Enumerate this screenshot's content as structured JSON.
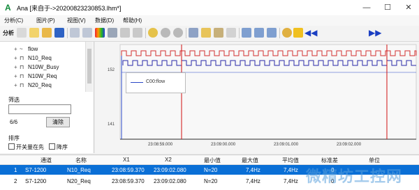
{
  "window": {
    "title": "Ana   [来自于->20200823230853.lhm*]",
    "app_letter": "A"
  },
  "menu": [
    "分析(C)",
    "图片(P)",
    "视图(V)",
    "数据(D)",
    "帮助(H)"
  ],
  "toolbar": {
    "first_label": "分析"
  },
  "tree": {
    "items": [
      {
        "icon": "~",
        "label": "flow"
      },
      {
        "icon": "⊓",
        "label": "N10_Req"
      },
      {
        "icon": "⊓",
        "label": "N10W_Busy"
      },
      {
        "icon": "⊓",
        "label": "N10W_Req"
      },
      {
        "icon": "⊓",
        "label": "N20_Req"
      }
    ]
  },
  "filter": {
    "label": "筛选",
    "count": "6/6",
    "clear_label": "清除"
  },
  "sort": {
    "label": "排序",
    "option1": "开关量在先",
    "option2": "降序"
  },
  "plot": {
    "legend": "C00:flow",
    "y_ticks": [
      "152",
      "141"
    ],
    "x_ticks": [
      "23:08:59.000",
      "23:09:00.000",
      "23:09:01.000",
      "23:09:02.000"
    ]
  },
  "table": {
    "headers": [
      "",
      "通道",
      "名称",
      "X1",
      "X2",
      "最小值",
      "最大值",
      "平均值",
      "标准差",
      "单位"
    ],
    "rows": [
      [
        "1",
        "S7-1200",
        "N10_Req",
        "23:08:59.370",
        "23:09:02.080",
        "N=20",
        "7,4Hz",
        "7,4Hz",
        "0",
        ""
      ],
      [
        "2",
        "S7-1200",
        "N20_Req",
        "23:08:59.370",
        "23:09:02.080",
        "N=20",
        "7,4Hz",
        "7,4Hz",
        "0",
        ""
      ]
    ]
  },
  "watermark": "微精坊工控网",
  "colors": {
    "signal_red": "#d23030",
    "signal_blue": "#2a2aa8",
    "cursor": "#d01010",
    "selection": "#0a6fd6"
  }
}
